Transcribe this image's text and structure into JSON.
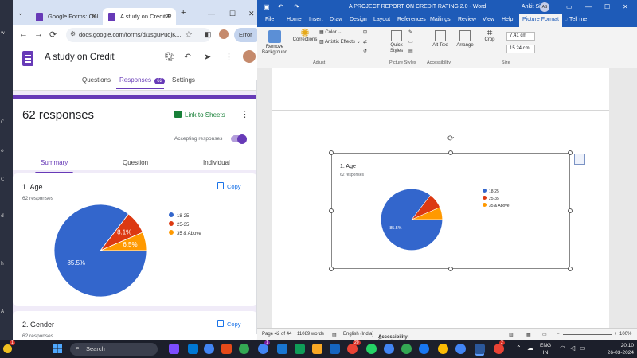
{
  "desktop": {
    "left_labels": [
      "w",
      "C",
      "o",
      "C",
      "d",
      "h",
      "A"
    ]
  },
  "browser": {
    "tabs": [
      {
        "label": "Google Forms: Onl"
      },
      {
        "label": "A study on Credit R"
      }
    ],
    "url": "docs.google.com/forms/d/1sguPudjK...",
    "error_label": "Error",
    "icons": {
      "back": "←",
      "forward": "→",
      "reload": "⟳",
      "star": "☆",
      "new_tab": "+",
      "minimize": "—",
      "maximize": "☐",
      "close": "✕"
    }
  },
  "forms": {
    "title": "A study on Credit",
    "tabs": {
      "questions": "Questions",
      "responses": "Responses",
      "responses_count": "62",
      "settings": "Settings"
    },
    "summary": {
      "count_label": "62 responses",
      "link_to_sheets": "Link to Sheets",
      "accepting_label": "Accepting responses",
      "subtabs": {
        "summary": "Summary",
        "question": "Question",
        "individual": "Individual"
      }
    },
    "question_1": {
      "title": "1. Age",
      "responses": "62 responses",
      "copy_label": "Copy",
      "slice_labels": [
        "85.5%",
        "8.1%",
        "6.5%"
      ]
    },
    "question_2": {
      "title": "2. Gender",
      "responses": "62 responses",
      "copy_label": "Copy"
    }
  },
  "chart_data": {
    "type": "pie",
    "title": "1. Age",
    "subtitle": "62 responses",
    "categories": [
      "18-25",
      "25-35",
      "35 & Above"
    ],
    "values": [
      85.5,
      8.1,
      6.5
    ],
    "colors": [
      "#3366cc",
      "#dc3912",
      "#ff9900"
    ],
    "legend_position": "right"
  },
  "word": {
    "title": "A PROJECT REPORT ON CREDIT RATING 2.0 - Word",
    "user": "Ankit Singh",
    "user_initials": "AS",
    "tabs": [
      "File",
      "Home",
      "Insert",
      "Draw",
      "Design",
      "Layout",
      "References",
      "Mailings",
      "Review",
      "View",
      "Help",
      "Picture Format"
    ],
    "tell_me": "Tell me",
    "ribbon": {
      "remove_background": "Remove Background",
      "corrections": "Corrections",
      "color": "Color",
      "artistic_effects": "Artistic Effects",
      "quick_styles": "Quick Styles",
      "alt_text": "Alt Text",
      "arrange": "Arrange",
      "crop": "Crop",
      "height": "7.41 cm",
      "width": "15.24 cm",
      "groups": {
        "adjust": "Adjust",
        "picture_styles": "Picture Styles",
        "accessibility": "Accessibility",
        "size": "Size"
      }
    },
    "picture": {
      "title": "1. Age",
      "subtitle": "62 responses",
      "slice_label": "85.5%"
    },
    "status": {
      "page": "Page 42 of 44",
      "words": "11089 words",
      "language": "English (India)",
      "accessibility": "Accessibility: Investigate",
      "zoom": "100%"
    }
  },
  "taskbar": {
    "search_placeholder": "Search",
    "lang_1": "ENG",
    "lang_2": "IN",
    "time": "20:10",
    "date": "26-03-2024",
    "badge_1": "1",
    "badge_2": "1",
    "badge_3": "20",
    "badge_4": "2"
  }
}
